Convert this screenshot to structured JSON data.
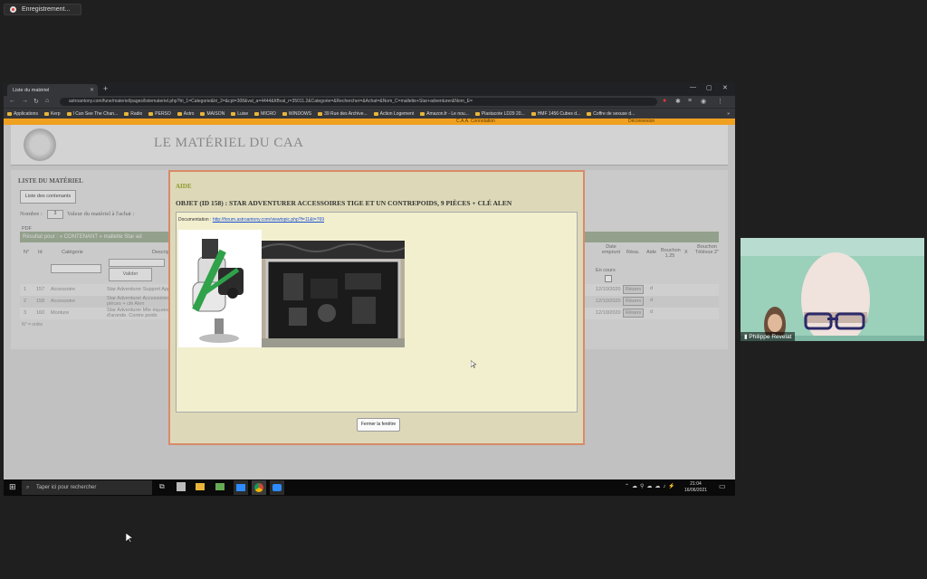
{
  "recording": {
    "label": "Enregistrement..."
  },
  "browser": {
    "tab_title": "Liste du matériel",
    "url": "astroantony.com/fune/materiel/pages/listemateriel.php?tri_1=Categorie&tri_2=&cpt=308&val_a=4444&ItBval_r=35011.2&Categorie=&Rechercher=&Achat=&Nom_C=mallette+Star+adventurer&Nom_E=",
    "bookmarks": [
      "Applications",
      "Kerp",
      "I Can See The Chan...",
      "Radio",
      "PERSO",
      "Astro",
      "MAISON",
      "Luise",
      "MICRO",
      "WINDOWS",
      "39 Rue des Archive...",
      "Action Logement",
      "Amazon.fr - Le nou...",
      "Plastacote LD29 20...",
      "HMF 1456 Cubes d...",
      "Coffre de sexuse d..."
    ],
    "more_bookmarks": "»"
  },
  "site": {
    "orange_left": "C.A.A. Connotation",
    "orange_right": "Déconnexion",
    "title": "LE MATÉRIEL DU CAA",
    "section": "LISTE DU MATÉRIEL",
    "btn_list": "Liste des contenants",
    "nombre_label": "Nombre :",
    "nombre_value": "3",
    "valeur_label": "Valeur du matériel à l'achat :",
    "pdf": "PDF",
    "result": "Résultat pour : » CONTENANT » mallette Star ad",
    "cols_left": [
      "N°",
      "Id",
      "Catégorie",
      "Descrip"
    ],
    "cols_right": [
      "Date emprunt",
      "Résa.",
      "Aide",
      "Bouchon 1.25",
      "X",
      "Bouchon Télévue 2\""
    ],
    "valider": "Valider",
    "en_cours": "En cours",
    "rows": [
      {
        "n": "1",
        "id": "157",
        "cat": "Accessoire",
        "desc": "Star Adventurer Support Appar",
        "date": "12/10/2020",
        "resa": "Réserv"
      },
      {
        "n": "2",
        "id": "158",
        "cat": "Accessoire",
        "desc": "Star Adventurer Accessoires Ti",
        "desc2": "pièces + clé Alen",
        "date": "12/10/2020",
        "resa": "Réserv"
      },
      {
        "n": "3",
        "id": "160",
        "cat": "Monture",
        "desc": "Star Adventurer Mte équatorial",
        "desc2": "d'aronde. Contre poids",
        "date": "12/10/2020",
        "resa": "Réserv"
      }
    ],
    "footer": "N° = ordre"
  },
  "modal": {
    "header": "AIDE",
    "title": "OBJET (ID 158) : STAR ADVENTURER ACCESSOIRES TIGE ET UN CONTREPOIDS, 9 PIÈCES + CLÉ ALEN",
    "doc_label": "Documentation :",
    "doc_link": "http://forum.astroantony.com/viewtopic.php?f=11&t=769",
    "close": "Fermer la fenêtre"
  },
  "taskbar": {
    "search": "Taper ici pour rechercher",
    "time": "21:04",
    "date": "16/06/2021"
  },
  "webcam": {
    "name": "Philippe Revelat"
  }
}
